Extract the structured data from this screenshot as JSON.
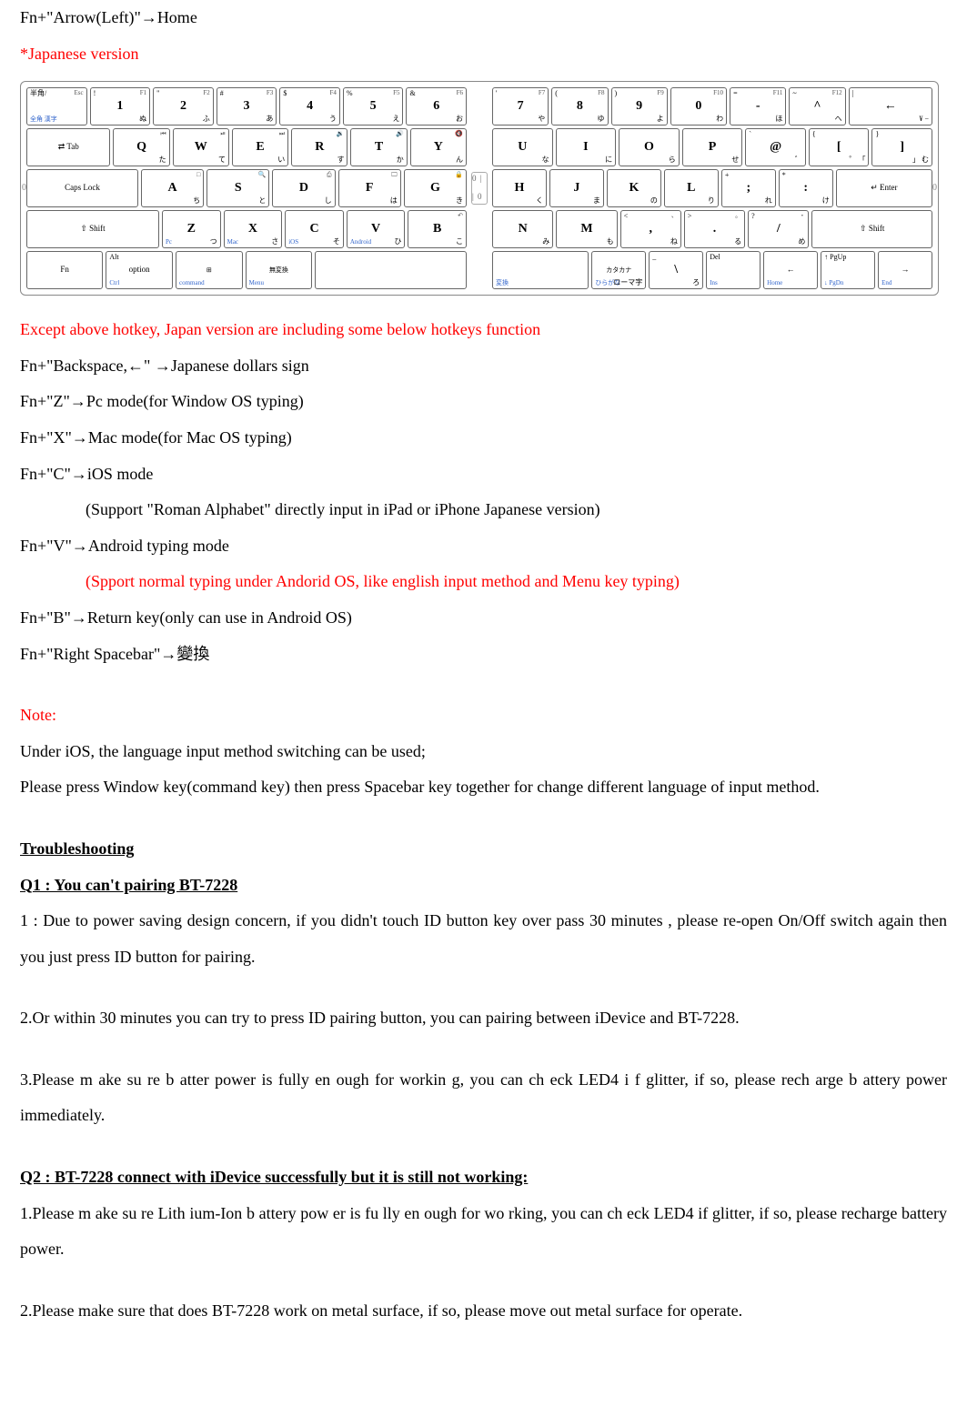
{
  "intro": {
    "line1_prefix": "Fn+\"Arrow(Left)\"",
    "line1_suffix": "Home",
    "japanese_version": "*Japanese version"
  },
  "keyboard": {
    "hinge": "0 | | 0",
    "left_edge": "0",
    "right_edge": "0",
    "left": [
      [
        {
          "tl": "半角/",
          "bl": "全角 漢字",
          "tr": "Esc"
        },
        {
          "tl": "!",
          "c": "1",
          "tr": "F1",
          "br": "ぬ"
        },
        {
          "tl": "\"",
          "c": "2",
          "tr": "F2",
          "br": "ふ"
        },
        {
          "tl": "#",
          "c": "3",
          "tr": "F3",
          "br": "あ"
        },
        {
          "tl": "$",
          "c": "4",
          "tr": "F4",
          "br": "う"
        },
        {
          "tl": "%",
          "c": "5",
          "tr": "F5",
          "br": "え"
        },
        {
          "tl": "&",
          "c": "6",
          "tr": "F6",
          "br": "お"
        }
      ],
      [
        {
          "mid": "⇄ Tab",
          "w": "w15"
        },
        {
          "c": "Q",
          "tr": "⏮",
          "br": "た"
        },
        {
          "c": "W",
          "tr": "⏯",
          "br": "て"
        },
        {
          "c": "E",
          "tr": "⏭",
          "br": "い"
        },
        {
          "c": "R",
          "tr": "🔉",
          "br": "す"
        },
        {
          "c": "T",
          "tr": "🔊",
          "br": "か"
        },
        {
          "c": "Y",
          "tr": "🔇",
          "br": "ん"
        }
      ],
      [
        {
          "mid": "Caps Lock",
          "w": "w175"
        },
        {
          "c": "A",
          "tr": "□",
          "br": "ち"
        },
        {
          "c": "S",
          "tr": "🔍",
          "br": "と"
        },
        {
          "c": "D",
          "tr": "⎙",
          "br": "し"
        },
        {
          "c": "F",
          "tr": "🖵",
          "br": "は"
        },
        {
          "c": "G",
          "tr": "🔒",
          "br": "き"
        }
      ],
      [
        {
          "mid": "⇧ Shift",
          "w": "w25"
        },
        {
          "c": "Z",
          "bl": "Pc",
          "br": "つ"
        },
        {
          "c": "X",
          "bl": "Mac",
          "br": "さ"
        },
        {
          "c": "C",
          "bl": "iOS",
          "br": "そ"
        },
        {
          "c": "V",
          "bl": "Android",
          "br": "ひ"
        },
        {
          "c": "B",
          "tr": "↶",
          "br": "こ"
        }
      ],
      [
        {
          "mid": "Fn",
          "w": "wfn"
        },
        {
          "tl": "Alt",
          "mid": "option",
          "bl": "Ctrl"
        },
        {
          "mid": "⊞",
          "bl": "command",
          "small": "1"
        },
        {
          "mid": "無変換",
          "bl": "Menu",
          "small": "1"
        },
        {
          "mid": " ",
          "w": "w25"
        }
      ]
    ],
    "right": [
      [
        {
          "tl": "'",
          "c": "7",
          "tr": "F7",
          "br": "や"
        },
        {
          "tl": "(",
          "c": "8",
          "tr": "F8",
          "br": "ゆ"
        },
        {
          "tl": ")",
          "c": "9",
          "tr": "F9",
          "br": "よ"
        },
        {
          "tl": "",
          "c": "0",
          "tr": "F10",
          "br": "わ"
        },
        {
          "tl": "=",
          "c": "-",
          "tr": "F11",
          "br": "ほ"
        },
        {
          "tl": "~",
          "c": "^",
          "tr": "F12",
          "br": "へ"
        },
        {
          "tl": "|",
          "c": "←",
          "br": "¥ −",
          "w": "w15"
        }
      ],
      [
        {
          "c": "U",
          "br": "な"
        },
        {
          "c": "I",
          "br": "に"
        },
        {
          "c": "O",
          "br": "ら"
        },
        {
          "c": "P",
          "br": "せ"
        },
        {
          "tl": "`",
          "c": "@",
          "br": "゛"
        },
        {
          "tl": "{",
          "c": "[",
          "br": "゜ 「"
        },
        {
          "tl": "}",
          "c": "]",
          "br": "」 む"
        }
      ],
      [
        {
          "c": "H",
          "br": "く"
        },
        {
          "c": "J",
          "br": "ま"
        },
        {
          "c": "K",
          "br": "の"
        },
        {
          "c": "L",
          "br": "り"
        },
        {
          "tl": "+",
          "c": ";",
          "br": "れ"
        },
        {
          "tl": "*",
          "c": ":",
          "br": "け"
        },
        {
          "mid": "↵ Enter",
          "w": "w175"
        }
      ],
      [
        {
          "c": "N",
          "br": "み"
        },
        {
          "c": "M",
          "br": "も"
        },
        {
          "tl": "<",
          "c": ",",
          "tr": "、",
          "br": "ね"
        },
        {
          "tl": ">",
          "c": ".",
          "tr": "。",
          "br": "る"
        },
        {
          "tl": "?",
          "c": "/",
          "tr": "・",
          "br": "め"
        },
        {
          "mid": "⇧ Shift",
          "w": "w2"
        }
      ],
      [
        {
          "mid": " ",
          "bl": "変換",
          "w": "w175"
        },
        {
          "mid": "カタカナ",
          "bl": "ひらがな",
          "br": "ローマ字",
          "small": "1"
        },
        {
          "tl": "_",
          "c": "\\",
          "br": "ろ"
        },
        {
          "tl": "Del",
          "bl": "Ins"
        },
        {
          "mid": "←",
          "bl": "Home"
        },
        {
          "tl": "↑ PgUp",
          "bl": "↓ PgDn"
        },
        {
          "mid": "→",
          "bl": "End"
        }
      ]
    ]
  },
  "hotkeys": {
    "heading": "Except above hotkey, Japan version are including some below hotkeys function",
    "lines": [
      {
        "pre": "Fn+\"Backspace,←\" ",
        "post": "Japanese dollars sign"
      },
      {
        "pre": "Fn+\"Z\"",
        "post": "Pc mode(for Window OS typing)"
      },
      {
        "pre": "Fn+\"X\"",
        "post": "Mac mode(for Mac OS typing)"
      },
      {
        "pre": "Fn+\"C\"",
        "post": "iOS mode"
      }
    ],
    "ios_sub": "(Support \"Roman Alphabet\" directly input in iPad or iPhone Japanese version)",
    "android": {
      "pre": "Fn+\"V\"",
      "post": "Android typing mode"
    },
    "android_sub": "(Spport normal typing under Andorid OS, like english input method and Menu key typing)",
    "b_line": {
      "pre": "Fn+\"B\"",
      "post": "Return key(only can use in Android OS)"
    },
    "space_line": {
      "pre": "Fn+\"Right Spacebar\"",
      "post": "變換"
    }
  },
  "note": {
    "heading": "Note:",
    "line1": "Under iOS, the language input method switching can be used;",
    "line2": "Please press Window key(command key) then press Spacebar key together for change different language of input method."
  },
  "troubleshooting": {
    "heading": "Troubleshooting",
    "q1_title": "Q1 : You can't pairing BT-7228  ",
    "q1_a1": "1 : Due to power saving design concern, if you didn't touch ID button key over pass 30 minutes , please re-open On/Off switch again then you just press ID button for pairing.",
    "q1_a2": "2.Or within 30 minutes you can try to press ID pairing button, you can pairing between iDevice and BT-7228.",
    "q1_a3": "3.Please m ake su re b atter  power is  fully en ough for workin g,  you can ch eck LED4  i f glitter, if so,   please rech arge b attery power immediately.",
    "q2_title": "Q2 : BT-7228 connect with iDevice successfully but it is still not working:",
    "q2_a1": "1.Please m ake su re Lith ium-Ion b attery pow er is fu  lly en ough  for wo rking, you can ch   eck LED4   if  glitter, if so,    please recharge battery power.",
    "q2_a2": "2.Please make sure that does BT-7228 work on metal surface, if so, please move out metal surface for operate."
  },
  "arrow": "→"
}
